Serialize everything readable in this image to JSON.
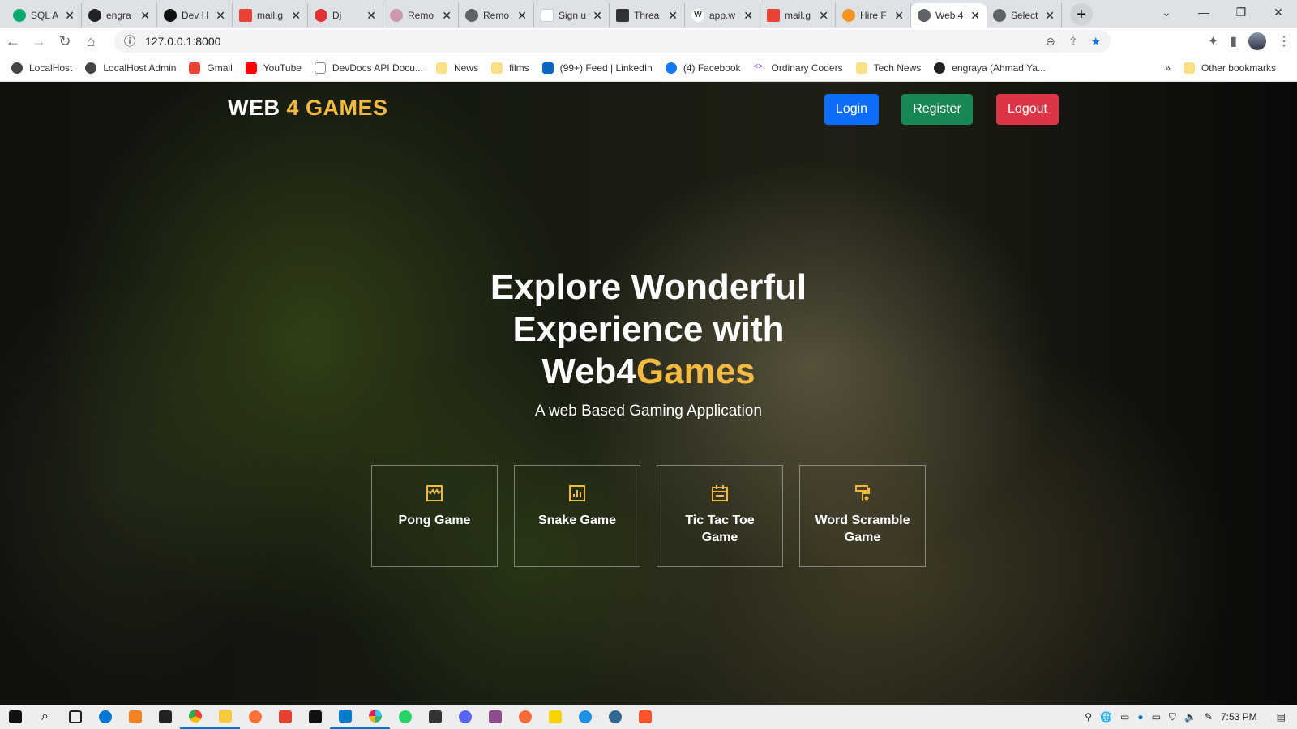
{
  "browser": {
    "tabs": [
      {
        "title": "SQL A",
        "icon": "w3schools-icon"
      },
      {
        "title": "engra",
        "icon": "github-icon"
      },
      {
        "title": "Dev H",
        "icon": "devhub-icon"
      },
      {
        "title": "mail.g",
        "icon": "gmail-icon"
      },
      {
        "title": "Dj",
        "icon": "django-icon"
      },
      {
        "title": "Remo",
        "icon": "remote-icon"
      },
      {
        "title": "Remo",
        "icon": "globe-icon"
      },
      {
        "title": "Sign u",
        "icon": "w-icon"
      },
      {
        "title": "Threa",
        "icon": "tr-icon"
      },
      {
        "title": "app.w",
        "icon": "wikipedia-icon"
      },
      {
        "title": "mail.g",
        "icon": "gmail-icon"
      },
      {
        "title": "Hire F",
        "icon": "hire-icon"
      },
      {
        "title": "Web 4",
        "icon": "globe-icon",
        "active": true
      },
      {
        "title": "Select",
        "icon": "globe-icon"
      }
    ],
    "url": "127.0.0.1:8000",
    "bookmarks": [
      "LocalHost",
      "LocalHost Admin",
      "Gmail",
      "YouTube",
      "DevDocs API Docu...",
      "News",
      "films",
      "(99+) Feed | LinkedIn",
      "(4) Facebook",
      "Ordinary Coders",
      "Tech News",
      "engraya (Ahmad Ya..."
    ],
    "other_bookmarks": "Other bookmarks",
    "overflow": "»"
  },
  "page": {
    "logo": {
      "part1": "WEB ",
      "part2": "4 GAMES"
    },
    "nav": {
      "login": "Login",
      "register": "Register",
      "logout": "Logout"
    },
    "hero": {
      "line1": "Explore Wonderful",
      "line2": "Experience with",
      "brand1": "Web4",
      "brand2": "Games",
      "subtitle": "A web Based Gaming Application"
    },
    "games": [
      {
        "label": "Pong Game",
        "icon": "store-icon"
      },
      {
        "label": "Snake Game",
        "icon": "bar-chart-icon"
      },
      {
        "label": "Tic Tac Toe Game",
        "icon": "calendar-icon"
      },
      {
        "label": "Word Scramble Game",
        "icon": "paint-roller-icon"
      }
    ],
    "accent": "#f4b941"
  },
  "taskbar": {
    "time": "7:53 PM"
  }
}
